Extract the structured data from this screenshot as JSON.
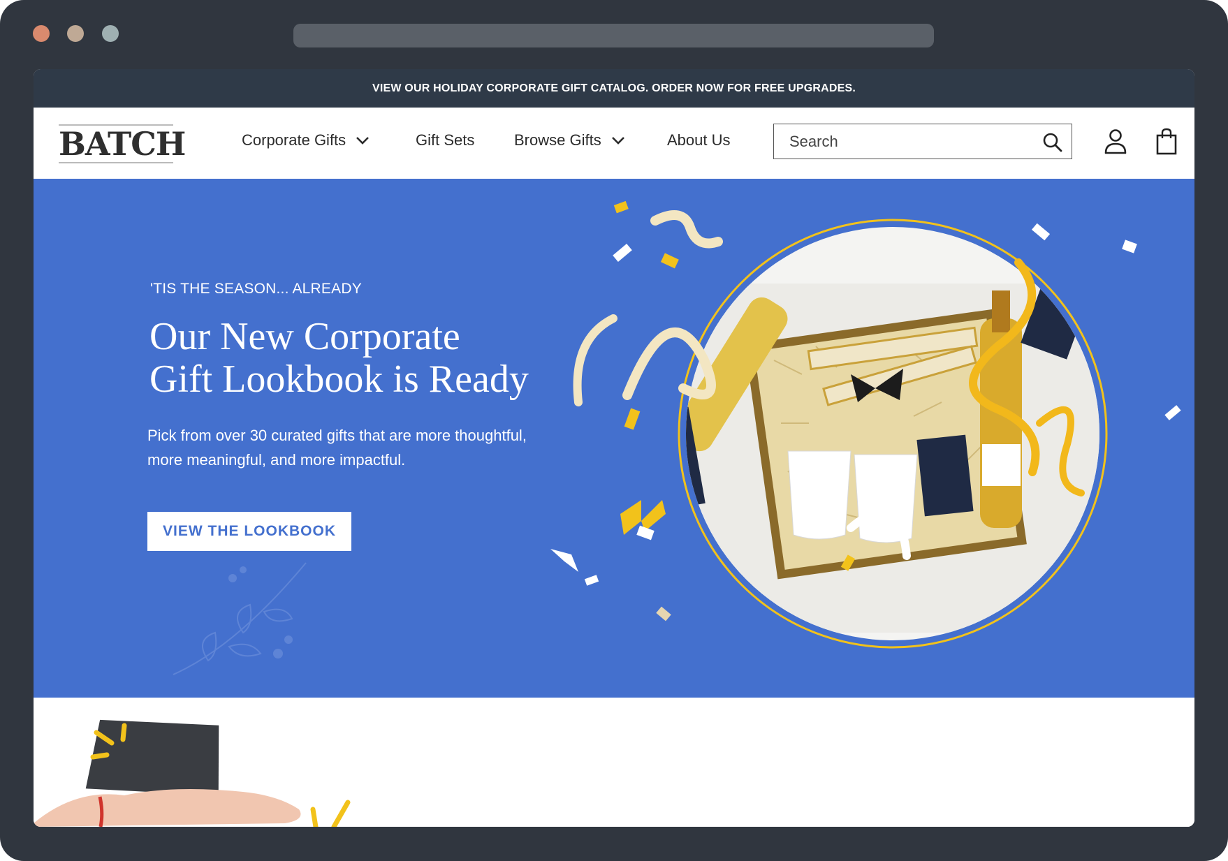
{
  "browser": {
    "traffic_lights": [
      "#d98a6e",
      "#bfa995",
      "#9fb0b2"
    ]
  },
  "announcement": {
    "text": "VIEW OUR HOLIDAY CORPORATE GIFT  CATALOG. ORDER NOW FOR FREE UPGRADES."
  },
  "nav": {
    "logo": "BATCH",
    "items": [
      {
        "label": "Corporate Gifts",
        "has_dropdown": true
      },
      {
        "label": "Gift Sets",
        "has_dropdown": false
      },
      {
        "label": "Browse Gifts",
        "has_dropdown": true
      },
      {
        "label": "About Us",
        "has_dropdown": false
      }
    ],
    "search": {
      "placeholder": "Search",
      "value": ""
    },
    "icons": [
      "search-icon",
      "user-icon",
      "shopping-bag-icon"
    ]
  },
  "hero": {
    "eyebrow": "'TIS THE SEASON... ALREADY",
    "title_line1": "Our New Corporate",
    "title_line2": "Gift Lookbook is Ready",
    "description": "Pick from over 30 curated gifts that are more thoughtful, more meaningful, and more impactful.",
    "cta": "VIEW THE LOOKBOOK",
    "background_color": "#4470ce",
    "accent_color": "#f2c21b"
  }
}
